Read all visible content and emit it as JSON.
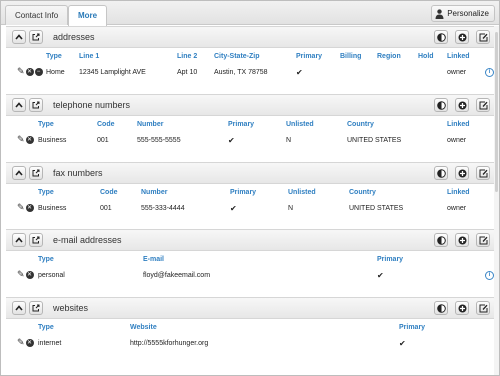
{
  "tabs": [
    {
      "label": "Contact Info",
      "active": false
    },
    {
      "label": "More",
      "active": true
    }
  ],
  "personalize_label": "Personalize",
  "sections": {
    "addresses": {
      "title": "addresses",
      "headers": [
        "Type",
        "Line 1",
        "Line 2",
        "City-State-Zip",
        "Primary",
        "Billing",
        "Region",
        "Hold",
        "Linked"
      ],
      "row": {
        "type": "Home",
        "line1": "12345 Lamplight AVE",
        "line2": "Apt 10",
        "csz": "Austin, TX 78758",
        "primary": "✔",
        "billing": "",
        "region": "",
        "hold": "",
        "linked": "owner"
      }
    },
    "telephone": {
      "title": "telephone numbers",
      "headers": [
        "Type",
        "Code",
        "Number",
        "Primary",
        "Unlisted",
        "Country",
        "Linked"
      ],
      "row": {
        "type": "Business",
        "code": "001",
        "number": "555-555-5555",
        "primary": "✔",
        "unlisted": "N",
        "country": "UNITED STATES",
        "linked": "owner"
      }
    },
    "fax": {
      "title": "fax numbers",
      "headers": [
        "Type",
        "Code",
        "Number",
        "Primary",
        "Unlisted",
        "Country",
        "Linked"
      ],
      "row": {
        "type": "Business",
        "code": "001",
        "number": "555-333-4444",
        "primary": "✔",
        "unlisted": "N",
        "country": "UNITED STATES",
        "linked": "owner"
      }
    },
    "email": {
      "title": "e-mail addresses",
      "headers": [
        "Type",
        "E-mail",
        "Primary"
      ],
      "row": {
        "type": "personal",
        "email": "floyd@fakeemail.com",
        "primary": "✔"
      }
    },
    "websites": {
      "title": "websites",
      "headers": [
        "Type",
        "Website",
        "Primary"
      ],
      "row": {
        "type": "internet",
        "website": "http://5555kforhunger.org",
        "primary": "✔"
      }
    }
  },
  "icons": {
    "collapse": "chevron-up-icon",
    "open": "open-icon",
    "theme": "contrast-icon",
    "add": "plus-icon",
    "edit": "edit-icon",
    "info": "info-icon",
    "person": "person-icon"
  },
  "colors": {
    "header_text": "#2f7fc1",
    "active_tab": "#2a7ab8"
  }
}
